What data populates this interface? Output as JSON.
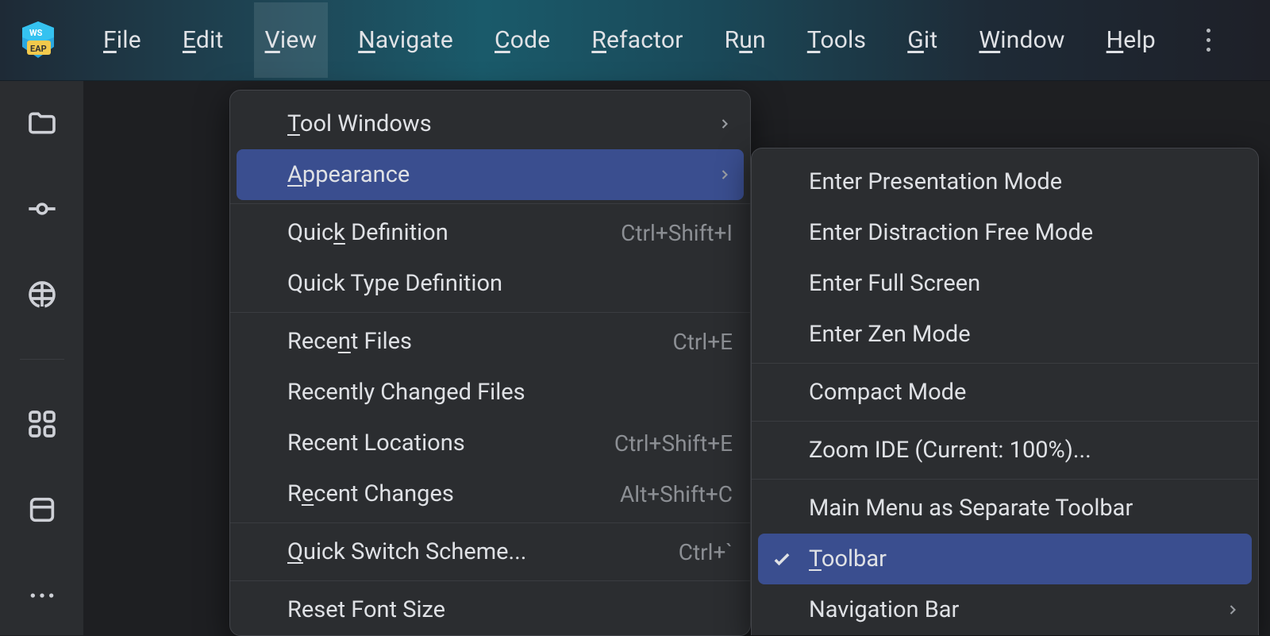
{
  "menubar": {
    "items": [
      {
        "pre": "",
        "mn": "F",
        "post": "ile"
      },
      {
        "pre": "",
        "mn": "E",
        "post": "dit"
      },
      {
        "pre": "",
        "mn": "V",
        "post": "iew"
      },
      {
        "pre": "",
        "mn": "N",
        "post": "avigate"
      },
      {
        "pre": "",
        "mn": "C",
        "post": "ode"
      },
      {
        "pre": "",
        "mn": "R",
        "post": "efactor"
      },
      {
        "pre": "R",
        "mn": "u",
        "post": "n"
      },
      {
        "pre": "",
        "mn": "T",
        "post": "ools"
      },
      {
        "pre": "",
        "mn": "G",
        "post": "it"
      },
      {
        "pre": "",
        "mn": "W",
        "post": "indow"
      },
      {
        "pre": "",
        "mn": "H",
        "post": "elp"
      }
    ]
  },
  "dropdown_view": [
    {
      "type": "item",
      "pre": "",
      "mn": "T",
      "post": "ool Windows",
      "submenu": true
    },
    {
      "type": "item",
      "pre": "",
      "mn": "A",
      "post": "ppearance",
      "submenu": true,
      "highlight": true
    },
    {
      "type": "sep"
    },
    {
      "type": "item",
      "pre": "Quic",
      "mn": "k",
      "post": " Definition",
      "shortcut": "Ctrl+Shift+I"
    },
    {
      "type": "item",
      "pre": "",
      "mn": "",
      "post": "Quick Type Definition"
    },
    {
      "type": "sep"
    },
    {
      "type": "item",
      "pre": "Rece",
      "mn": "n",
      "post": "t Files",
      "shortcut": "Ctrl+E"
    },
    {
      "type": "item",
      "pre": "",
      "mn": "",
      "post": "Recently Changed Files"
    },
    {
      "type": "item",
      "pre": "",
      "mn": "",
      "post": "Recent Locations",
      "shortcut": "Ctrl+Shift+E"
    },
    {
      "type": "item",
      "pre": "R",
      "mn": "e",
      "post": "cent Changes",
      "shortcut": "Alt+Shift+C"
    },
    {
      "type": "sep"
    },
    {
      "type": "item",
      "pre": "",
      "mn": "Q",
      "post": "uick Switch Scheme...",
      "shortcut": "Ctrl+`"
    },
    {
      "type": "sep"
    },
    {
      "type": "item",
      "pre": "",
      "mn": "",
      "post": "Reset Font Size"
    }
  ],
  "dropdown_appearance": [
    {
      "type": "item",
      "pre": "",
      "mn": "",
      "post": "Enter Presentation Mode"
    },
    {
      "type": "item",
      "pre": "",
      "mn": "",
      "post": "Enter Distraction Free Mode"
    },
    {
      "type": "item",
      "pre": "",
      "mn": "",
      "post": "Enter Full Screen"
    },
    {
      "type": "item",
      "pre": "",
      "mn": "",
      "post": "Enter Zen Mode"
    },
    {
      "type": "sep"
    },
    {
      "type": "item",
      "pre": "",
      "mn": "",
      "post": "Compact Mode"
    },
    {
      "type": "sep"
    },
    {
      "type": "item",
      "pre": "",
      "mn": "",
      "post": "Zoom IDE (Current: 100%)..."
    },
    {
      "type": "sep"
    },
    {
      "type": "item",
      "pre": "",
      "mn": "",
      "post": "Main Menu as Separate Toolbar"
    },
    {
      "type": "item",
      "pre": "",
      "mn": "T",
      "post": "oolbar",
      "checked": true,
      "highlight": true
    },
    {
      "type": "item",
      "pre": "",
      "mn": "",
      "post": "Navigation Bar",
      "submenu": true
    }
  ]
}
